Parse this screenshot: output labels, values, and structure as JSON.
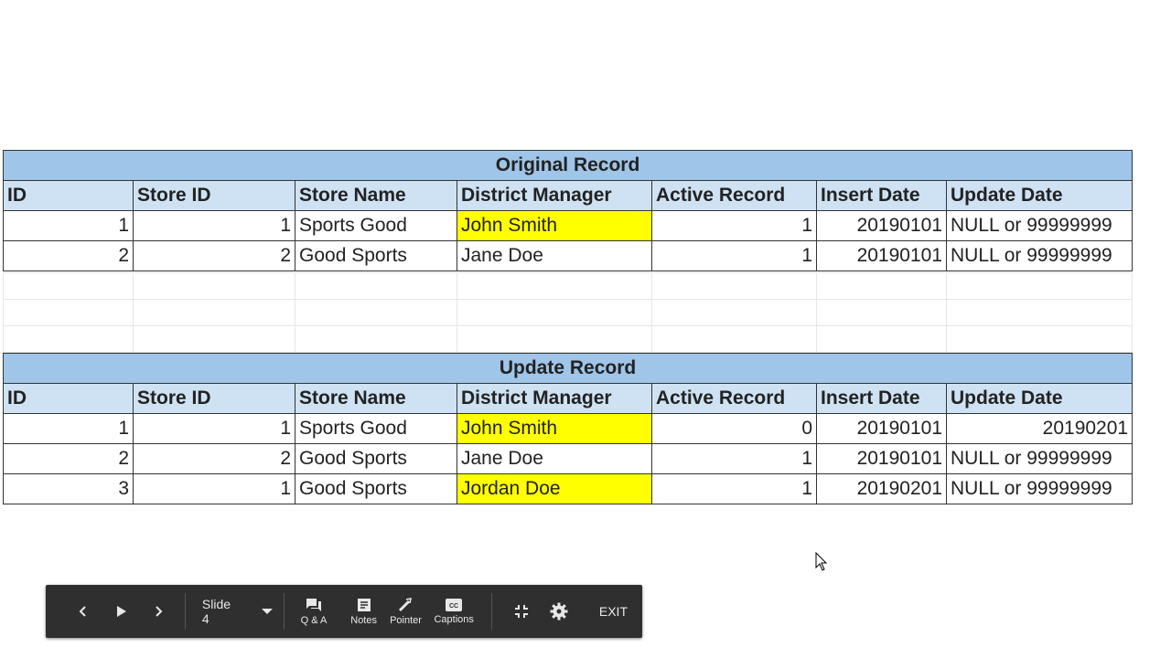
{
  "original": {
    "title": "Original Record",
    "columns": [
      "ID",
      "Store ID",
      "Store Name",
      "District Manager",
      "Active Record",
      "Insert Date",
      "Update Date"
    ],
    "rows": [
      [
        "1",
        "1",
        "Sports Good",
        "John Smith",
        "1",
        "20190101",
        "NULL or 99999999"
      ],
      [
        "2",
        "2",
        "Good Sports",
        "Jane Doe",
        "1",
        "20190101",
        "NULL or 99999999"
      ]
    ]
  },
  "update": {
    "title": "Update Record",
    "columns": [
      "ID",
      "Store ID",
      "Store Name",
      "District Manager",
      "Active Record",
      "Insert Date",
      "Update Date"
    ],
    "rows": [
      [
        "1",
        "1",
        "Sports Good",
        "John Smith",
        "0",
        "20190101",
        "20190201"
      ],
      [
        "2",
        "2",
        "Good Sports",
        "Jane Doe",
        "1",
        "20190101",
        "NULL or 99999999"
      ],
      [
        "3",
        "1",
        "Good Sports",
        "Jordan Doe",
        "1",
        "20190201",
        "NULL or 99999999"
      ]
    ]
  },
  "highlight_color": "#ffff00",
  "toolbar": {
    "prev_icon": "chevron-left-icon",
    "play_icon": "play-icon",
    "next_icon": "chevron-right-icon",
    "slide_label": "Slide 4",
    "qa_label": "Q & A",
    "notes_label": "Notes",
    "pointer_label": "Pointer",
    "captions_label": "Captions",
    "exit_label": "EXIT"
  }
}
